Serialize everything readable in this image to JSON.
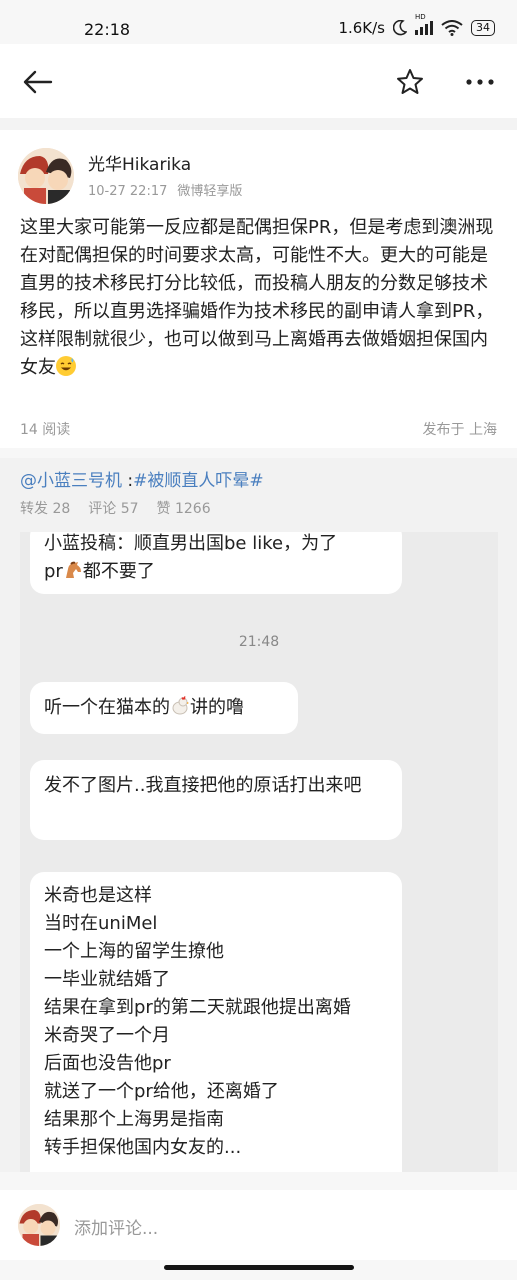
{
  "status": {
    "time": "22:18",
    "net_speed": "1.6K/s",
    "hd_label": "HD",
    "battery": "34"
  },
  "post": {
    "username": "光华Hikarika",
    "datetime": "10-27 22:17",
    "client": "微博轻享版",
    "body": "这里大家可能第一反应都是配偶担保PR，但是考虑到澳洲现在对配偶担保的时间要求太高，可能性不大。更大的可能是直男的技术移民打分比较低，而投稿人朋友的分数足够技术移民，所以直男选择骗婚作为技术移民的副申请人拿到PR，这样限制就很少，也可以做到马上离婚再去做婚姻担保国内女友",
    "read_count": "14 阅读",
    "location": "发布于 上海"
  },
  "repost": {
    "author": "@小蓝三号机",
    "separator": " :",
    "hashtag": "#被顺直人吓晕#",
    "forwards": "转发 28",
    "comments": "评论 57",
    "likes": "赞 1266"
  },
  "chat": {
    "msg1_line1": "小蓝投稿：顺直男出国be like，为了",
    "msg1_line2_a": "pr",
    "msg1_line2_b": "都不要了",
    "time": "21:48",
    "msg2_a": "听一个在猫本的",
    "msg2_b": "讲的噜",
    "msg3": "发不了图片..我直接把他的原话打出来吧",
    "msg4_lines": [
      "米奇也是这样",
      "当时在uniMel",
      "一个上海的留学生撩他",
      "一毕业就结婚了",
      "结果在拿到pr的第二天就跟他提出离婚",
      "米奇哭了一个月",
      "后面也没告他pr",
      "就送了一个pr给他，还离婚了",
      "结果那个上海男是指南",
      "转手担保他国内女友的..."
    ]
  },
  "comment": {
    "placeholder": "添加评论..."
  },
  "icons": {
    "back": "arrow-left-icon",
    "favorite": "star-outline-icon",
    "more": "more-dots-icon"
  }
}
